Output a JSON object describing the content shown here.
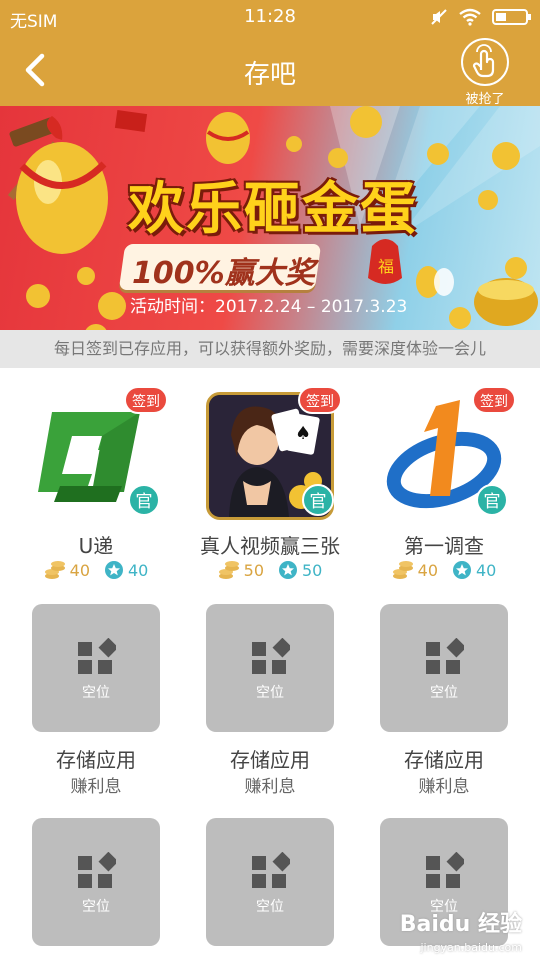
{
  "status_bar": {
    "carrier": "无SIM",
    "time": "11:28",
    "icons": [
      "mute-icon",
      "wifi-icon",
      "battery-icon"
    ]
  },
  "header": {
    "title": "存吧",
    "back_icon": "chevron-left-icon",
    "grab_label": "被抢了",
    "grab_icon": "hand-tap-icon"
  },
  "banner": {
    "title": "欢乐砸金蛋",
    "subtitle": "100%赢大奖",
    "time_text": "活动时间：2017.2.24 – 2017.3.23"
  },
  "notice": "每日签到已存应用，可以获得额外奖励，需要深度体验一会儿",
  "apps": [
    {
      "name": "U递",
      "coins": "40",
      "stars": "40",
      "sign_badge": "签到",
      "official_badge": "官",
      "icon": "u-di-logo"
    },
    {
      "name": "真人视频赢三张",
      "coins": "50",
      "stars": "50",
      "sign_badge": "签到",
      "official_badge": "官",
      "icon": "poker-game-icon"
    },
    {
      "name": "第一调查",
      "coins": "40",
      "stars": "40",
      "sign_badge": "签到",
      "official_badge": "官",
      "icon": "diyi-survey-logo"
    }
  ],
  "slots": [
    {
      "label": "空位",
      "name": "存储应用",
      "sub": "赚利息"
    },
    {
      "label": "空位",
      "name": "存储应用",
      "sub": "赚利息"
    },
    {
      "label": "空位",
      "name": "存储应用",
      "sub": "赚利息"
    },
    {
      "label": "空位"
    },
    {
      "label": "空位"
    },
    {
      "label": "空位"
    }
  ],
  "watermark": {
    "brand": "Baidu 经验",
    "url": "jingyan.baidu.com"
  },
  "colors": {
    "header": "#dba33c",
    "coin": "#d9a441",
    "star": "#3fb4c6",
    "badge_red": "#ea4a3e",
    "badge_teal": "#2bb3a6",
    "slot_gray": "#bdbdbd"
  }
}
